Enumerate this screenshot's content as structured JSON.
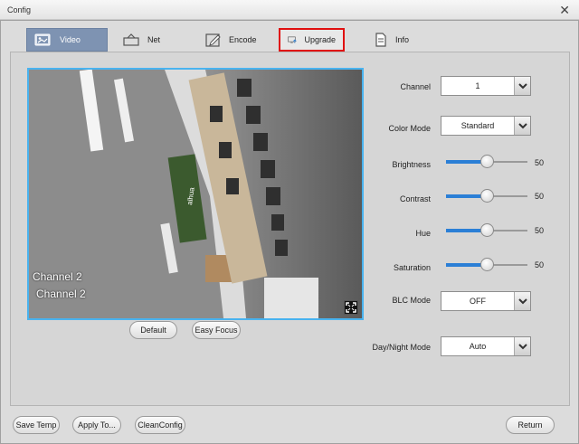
{
  "window": {
    "title": "Config",
    "close_glyph": "✕"
  },
  "tabs": [
    {
      "label": "Video",
      "icon": "image-icon",
      "active": true
    },
    {
      "label": "Net",
      "icon": "network-icon"
    },
    {
      "label": "Encode",
      "icon": "edit-icon"
    },
    {
      "label": "Upgrade",
      "icon": "monitor-upgrade-icon",
      "highlighted": true
    },
    {
      "label": "Info",
      "icon": "document-icon"
    }
  ],
  "video": {
    "osd_lines": [
      "Channel 2",
      "Channel 2"
    ],
    "default_label": "Default",
    "easy_focus_label": "Easy Focus"
  },
  "settings": {
    "channel": {
      "label": "Channel",
      "value": "1"
    },
    "color_mode": {
      "label": "Color Mode",
      "value": "Standard"
    },
    "brightness": {
      "label": "Brightness",
      "value": "50",
      "level": 0.5
    },
    "contrast": {
      "label": "Contrast",
      "value": "50",
      "level": 0.5
    },
    "hue": {
      "label": "Hue",
      "value": "50",
      "level": 0.5
    },
    "saturation": {
      "label": "Saturation",
      "value": "50",
      "level": 0.5
    },
    "blc_mode": {
      "label": "BLC Mode",
      "value": "OFF"
    },
    "day_night_mode": {
      "label": "Day/Night Mode",
      "value": "Auto"
    }
  },
  "footer": {
    "save_temp": "Save Temp",
    "apply_to": "Apply To...",
    "clean_config": "CleanConfig",
    "return": "Return"
  },
  "colors": {
    "accent": "#2b7fd6",
    "active_tab": "#7e93b2",
    "highlight_border": "#e01010",
    "video_border": "#49b3ef"
  }
}
